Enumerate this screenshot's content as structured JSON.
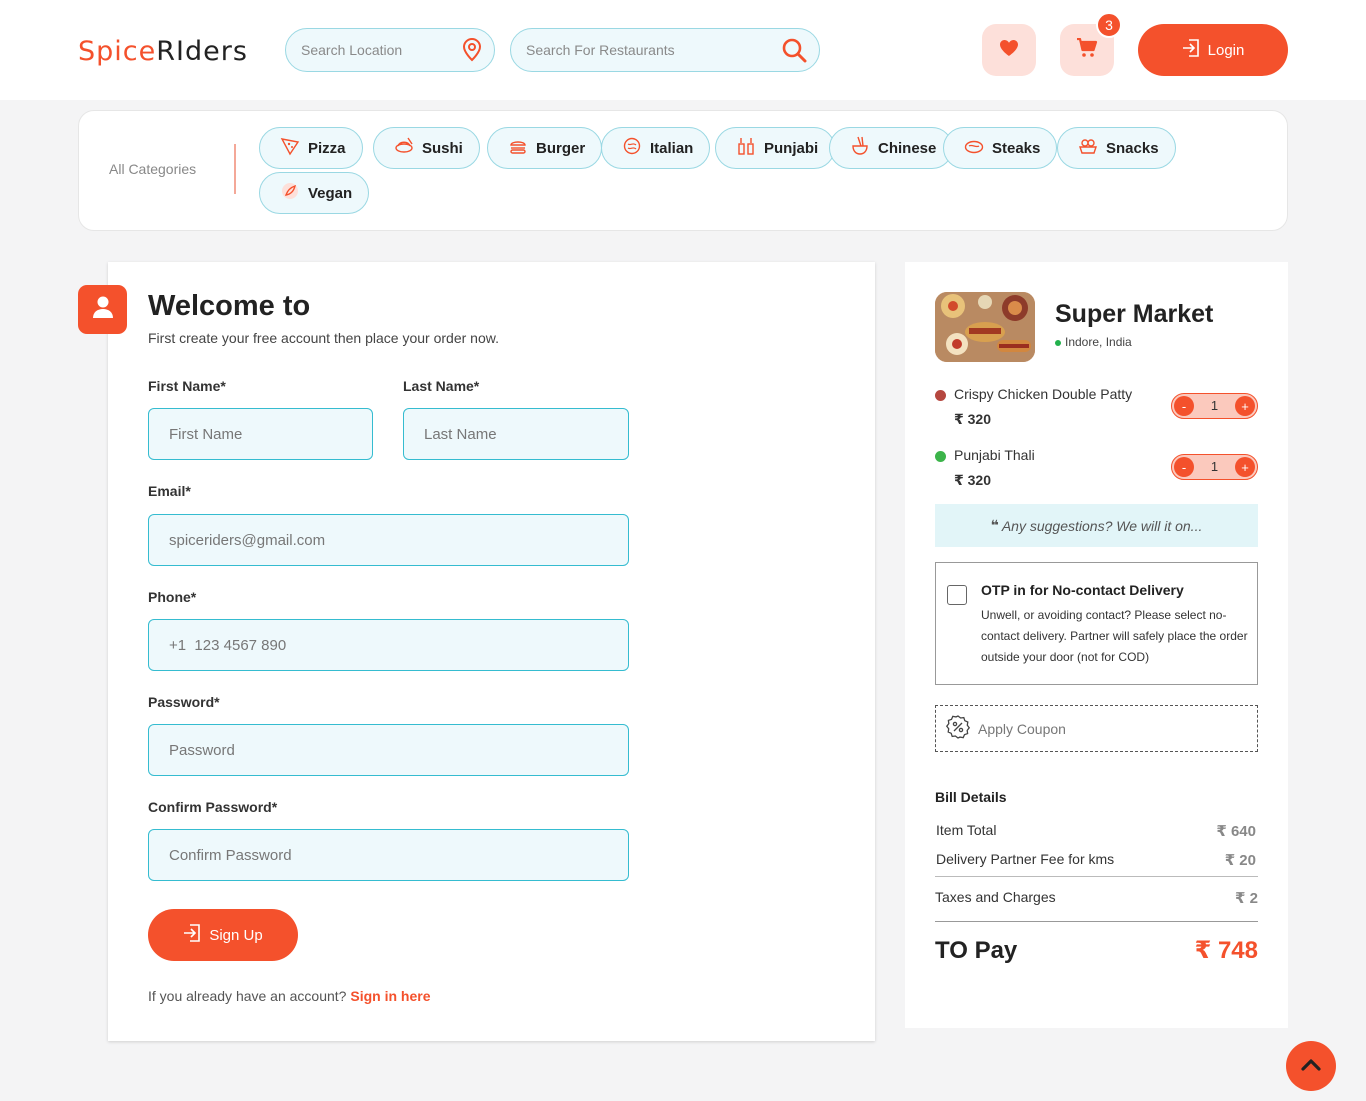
{
  "header": {
    "logo_part1": "Spice",
    "logo_part2": "RIders",
    "location_placeholder": "Search Location",
    "restaurant_placeholder": "Search For Restaurants",
    "cart_count": "3",
    "login_label": "Login"
  },
  "categories": {
    "label": "All Categories",
    "items": [
      {
        "label": "Pizza",
        "icon": "pizza-icon"
      },
      {
        "label": "Sushi",
        "icon": "sushi-icon"
      },
      {
        "label": "Burger",
        "icon": "burger-icon"
      },
      {
        "label": "Italian",
        "icon": "italian-icon"
      },
      {
        "label": "Punjabi",
        "icon": "punjabi-icon"
      },
      {
        "label": "Chinese",
        "icon": "chinese-icon"
      },
      {
        "label": "Steaks",
        "icon": "steak-icon"
      },
      {
        "label": "Snacks",
        "icon": "snacks-icon"
      },
      {
        "label": "Vegan",
        "icon": "vegan-icon"
      }
    ]
  },
  "form": {
    "title": "Welcome to",
    "subtitle": "First create your free account then place your order now.",
    "first_name_label": "First Name*",
    "first_name_placeholder": "First Name",
    "last_name_label": "Last Name*",
    "last_name_placeholder": "Last Name",
    "email_label": "Email*",
    "email_placeholder": "spiceriders@gmail.com",
    "phone_label": "Phone*",
    "phone_placeholder": "+1  123 4567 890",
    "password_label": "Password*",
    "password_placeholder": "Password",
    "confirm_label": "Confirm Password*",
    "confirm_placeholder": "Confirm Password",
    "signup_label": "Sign Up",
    "already_text": "If you already have an account?",
    "signin_link": "Sign in here"
  },
  "cart": {
    "store_name": "Super Market",
    "store_location": "Indore, India",
    "items": [
      {
        "name": "Crispy Chicken Double Patty",
        "price": "₹ 320",
        "qty": "1",
        "type_color": "#b5473f"
      },
      {
        "name": "Punjabi Thali",
        "price": "₹ 320",
        "qty": "1",
        "type_color": "#3cb44a"
      }
    ],
    "minus": "-",
    "plus": "+",
    "suggestion": "Any suggestions? We will it on...",
    "otp_title": "OTP in for No-contact Delivery",
    "otp_desc": "Unwell, or avoiding contact? Please select no-contact delivery. Partner will safely place the order outside your door (not for COD)",
    "coupon_label": "Apply Coupon",
    "bill_title": "Bill Details",
    "bill": [
      {
        "label": "Item Total",
        "value": "₹ 640"
      },
      {
        "label": "Delivery Partner Fee for kms",
        "value": "₹ 20"
      },
      {
        "label": "Taxes and Charges",
        "value": "₹ 2"
      }
    ],
    "to_pay_label": "TO Pay",
    "to_pay_value": "₹ 748"
  },
  "colors": {
    "accent": "#f4512c",
    "field_bg": "#eef9fc",
    "field_border": "#35bcd0"
  }
}
